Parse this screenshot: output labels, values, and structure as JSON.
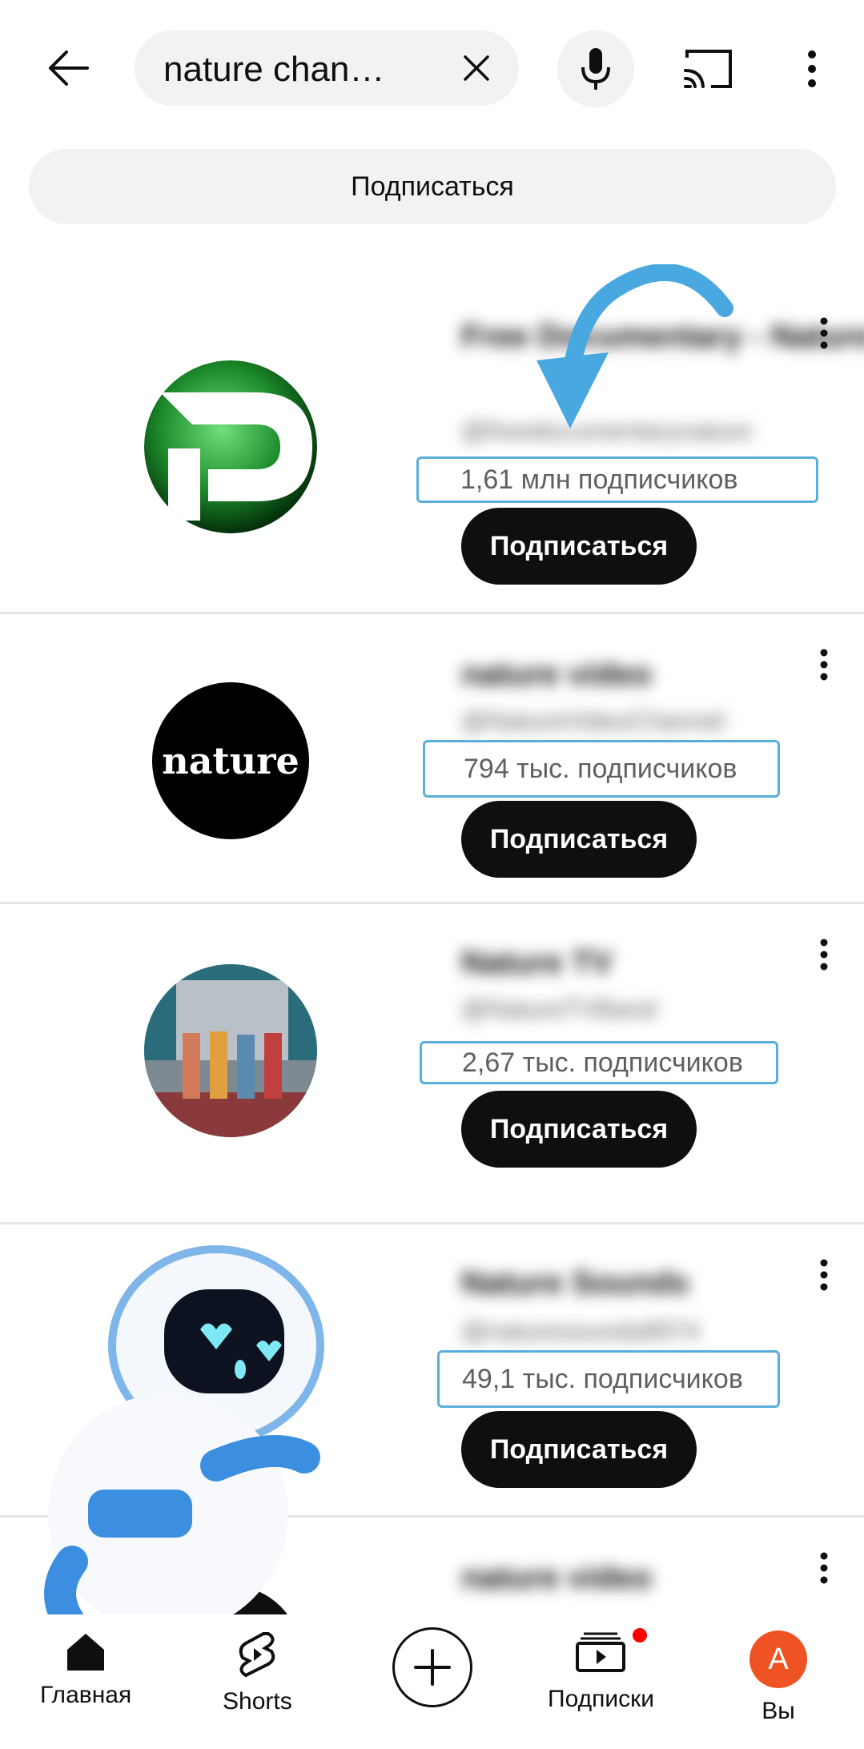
{
  "search": {
    "query": "nature chan…"
  },
  "filter": {
    "label": "Подписаться"
  },
  "channels": [
    {
      "name": "Free Documentary - Nature",
      "handle": "@freedocumentarynature",
      "subs": "1,61 млн подписчиков",
      "button": "Подписаться"
    },
    {
      "name": "nature video",
      "handle": "@NatureVideoChannel",
      "subs": "794 тыс. подписчиков",
      "button": "Подписаться"
    },
    {
      "name": "Nature TV",
      "handle": "@NatureTVBand",
      "subs": "2,67 тыс. подписчиков",
      "button": "Подписаться"
    },
    {
      "name": "Nature Sounds",
      "handle": "@naturesounds8974",
      "subs": "49,1 тыс. подписчиков",
      "button": "Подписаться"
    },
    {
      "name": "nature video",
      "handle": ""
    }
  ],
  "avatar_text": {
    "nature_logo": "nature"
  },
  "nav": {
    "home": "Главная",
    "shorts": "Shorts",
    "subscriptions": "Подписки",
    "you": "Вы",
    "profile_initial": "A"
  },
  "colors": {
    "highlight": "#5aaedc",
    "arrow": "#4aa8e0",
    "accent_red": "#ff0000",
    "profile": "#ef5323"
  }
}
